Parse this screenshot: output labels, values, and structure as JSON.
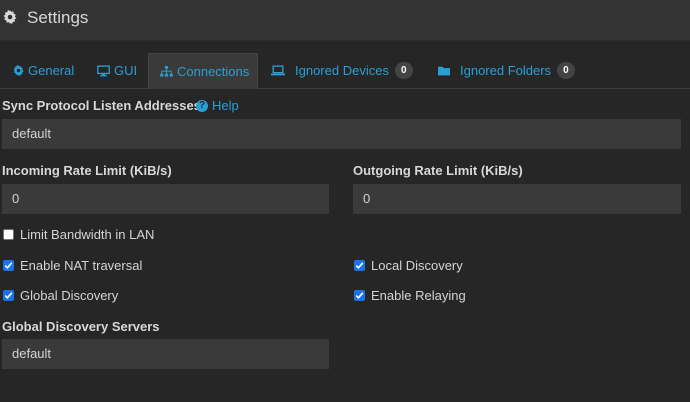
{
  "header": {
    "title": "Settings",
    "icon": "gear-icon"
  },
  "tabs": [
    {
      "label": "General",
      "icon": "gear-icon",
      "active": false
    },
    {
      "label": "GUI",
      "icon": "desktop-icon",
      "active": false
    },
    {
      "label": "Connections",
      "icon": "sitemap-icon",
      "active": true
    },
    {
      "label": "Ignored Devices",
      "icon": "laptop-icon",
      "badge": "0",
      "active": false
    },
    {
      "label": "Ignored Folders",
      "icon": "folder-icon",
      "badge": "0",
      "active": false
    }
  ],
  "form": {
    "listen_addresses": {
      "label": "Sync Protocol Listen Addresses",
      "help": "Help",
      "value": "default"
    },
    "incoming_rate": {
      "label": "Incoming Rate Limit (KiB/s)",
      "value": "0"
    },
    "outgoing_rate": {
      "label": "Outgoing Rate Limit (KiB/s)",
      "value": "0"
    },
    "checkboxes": {
      "limit_lan": {
        "label": "Limit Bandwidth in LAN",
        "checked": false
      },
      "nat": {
        "label": "Enable NAT traversal",
        "checked": true
      },
      "local_discovery": {
        "label": "Local Discovery",
        "checked": true
      },
      "global_discovery": {
        "label": "Global Discovery",
        "checked": true
      },
      "relaying": {
        "label": "Enable Relaying",
        "checked": true
      }
    },
    "discovery_servers": {
      "label": "Global Discovery Servers",
      "value": "default"
    }
  },
  "colors": {
    "accent": "#2a9fd6",
    "background": "#262626",
    "header": "#333333",
    "input": "#3a3a3a",
    "checkbox": "#1a73e8"
  }
}
